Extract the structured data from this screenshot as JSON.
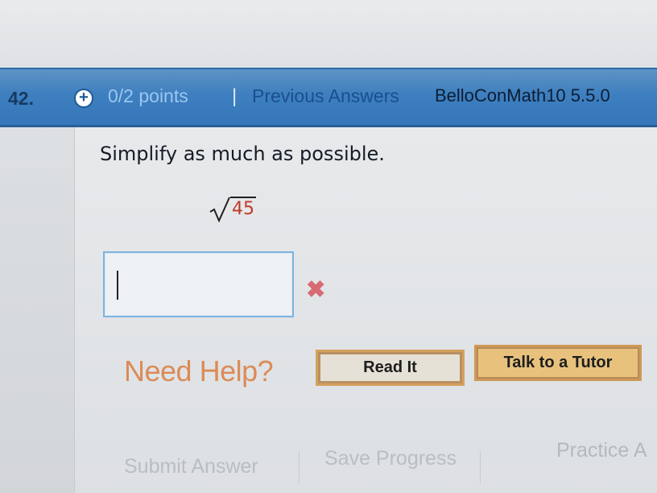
{
  "header": {
    "question_number": "42.",
    "points": "0/2 points",
    "separator": "|",
    "previous_answers": "Previous Answers",
    "course_code": "BelloConMath10 5.5.0"
  },
  "question": {
    "prompt": "Simplify as much as possible.",
    "radicand": "45",
    "answer_value": "",
    "status_icon": "x-mark"
  },
  "help": {
    "need_help_label": "Need Help?",
    "read_it_label": "Read It",
    "talk_tutor_label": "Talk to a Tutor"
  },
  "actions": {
    "submit_label": "Submit Answer",
    "save_label": "Save Progress",
    "practice_label": "Practice A"
  },
  "colors": {
    "header_blue": "#3e7fbf",
    "points_color": "#9bc6ef",
    "previous_answers_color": "#1a4e8f",
    "radicand_red": "#c0392b",
    "wrong_pink": "#d76b73",
    "help_orange": "#db8b57"
  }
}
